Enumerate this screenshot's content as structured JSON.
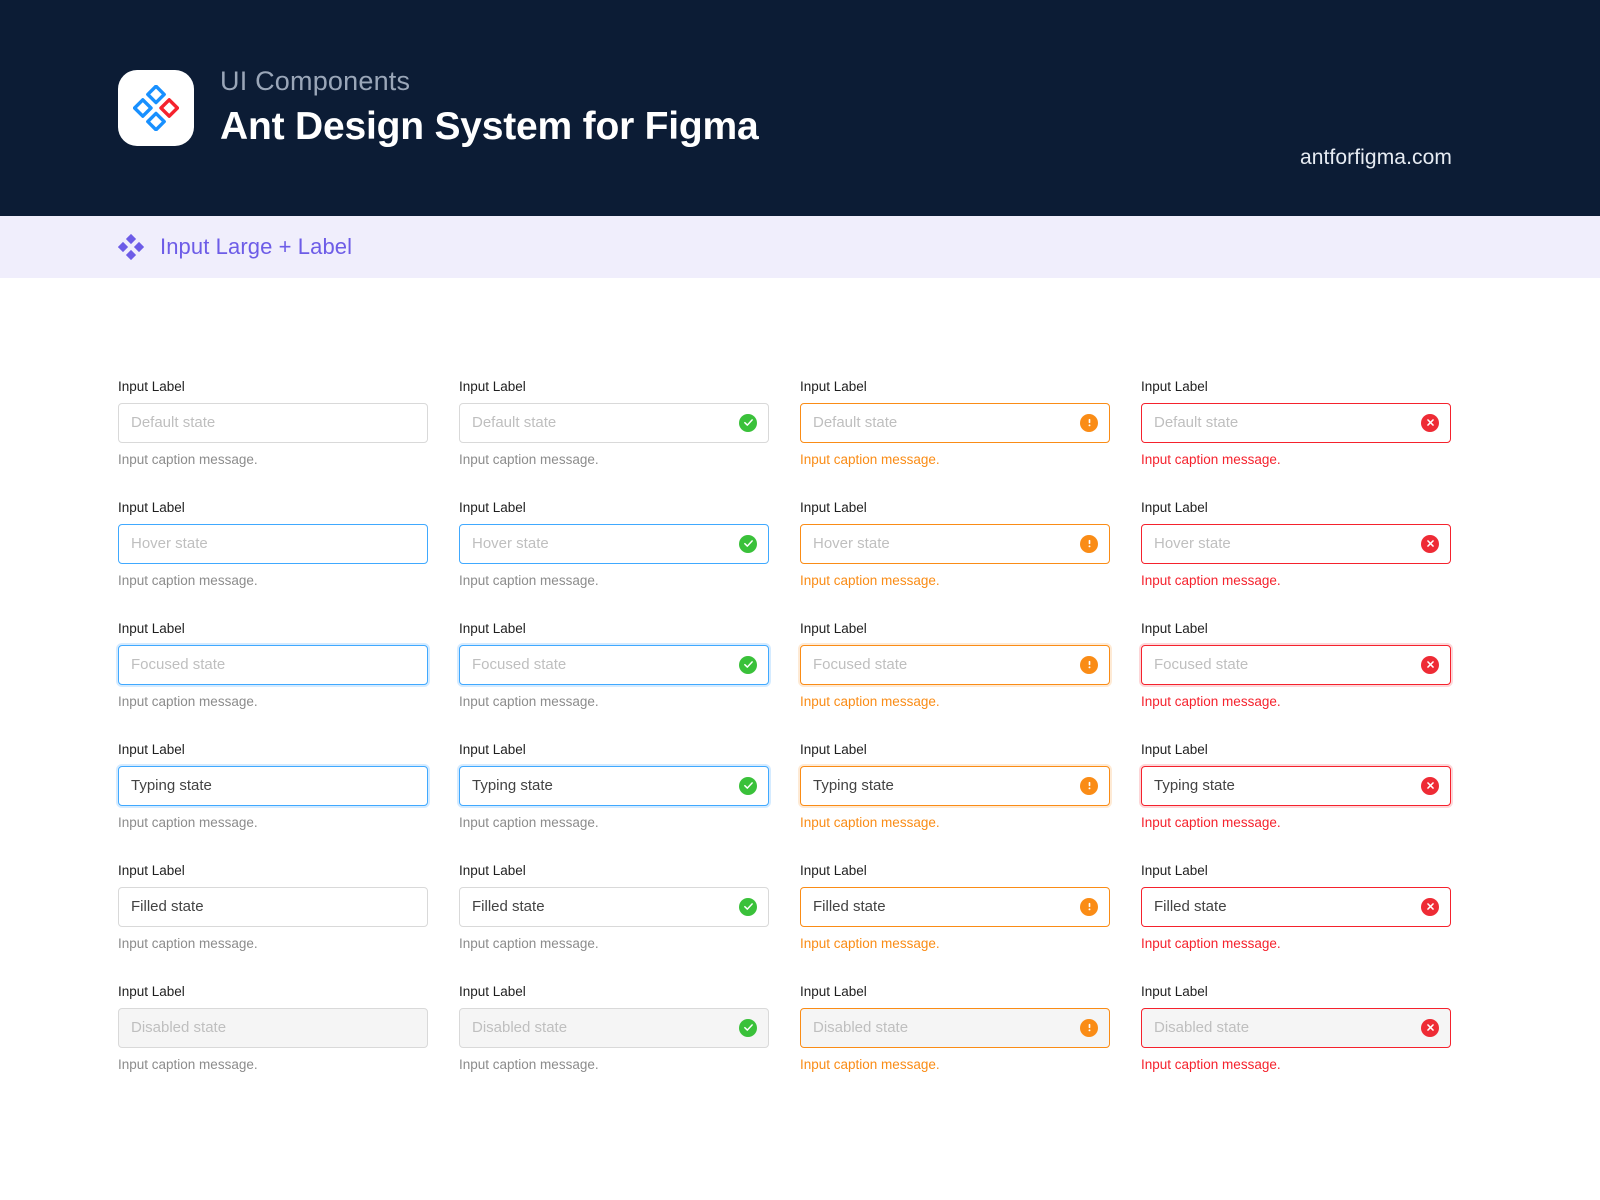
{
  "header": {
    "eyebrow": "UI Components",
    "title": "Ant Design System for Figma",
    "url": "antforfigma.com",
    "logo_icon": "ant-design-diamonds-logo-icon",
    "background_color": "#0c1c35"
  },
  "section": {
    "icon": "four-diamonds-icon",
    "title": "Input Large + Label",
    "background_color": "#f0eefc",
    "text_color": "#6d5ce7"
  },
  "colors": {
    "default_border": "#d9d9d9",
    "primary_blue": "#40a9ff",
    "success_green": "#3ac13a",
    "warning_orange": "#fa8c16",
    "error_red": "#f5222d",
    "disabled_fill": "#f5f5f5",
    "label_text": "#1f1f1f",
    "placeholder_text": "#bfbfbf",
    "value_text": "#434343",
    "caption_text": "#8c8c8c"
  },
  "common": {
    "label": "Input Label",
    "caption": "Input caption message."
  },
  "columns": [
    {
      "name": "neutral",
      "status_icon": null
    },
    {
      "name": "success",
      "status_icon": "check-circle-icon"
    },
    {
      "name": "warning",
      "status_icon": "exclamation-circle-icon"
    },
    {
      "name": "error",
      "status_icon": "close-circle-icon"
    }
  ],
  "rows": [
    {
      "state": "default",
      "value": "Default state"
    },
    {
      "state": "hover",
      "value": "Hover state"
    },
    {
      "state": "focused",
      "value": "Focused state"
    },
    {
      "state": "typing",
      "value": "Typing state"
    },
    {
      "state": "filled",
      "value": "Filled state"
    },
    {
      "state": "disabled",
      "value": "Disabled state"
    }
  ],
  "fields": [
    {
      "label": "Input Label",
      "value": "Default state",
      "caption": "Input caption message.",
      "box_class": "b-default",
      "caption_class": "c-default",
      "icon": null,
      "filled": false,
      "disabled": false
    },
    {
      "label": "Input Label",
      "value": "Default state",
      "caption": "Input caption message.",
      "box_class": "b-default",
      "caption_class": "c-default",
      "icon": "check-circle-icon",
      "filled": false,
      "disabled": false
    },
    {
      "label": "Input Label",
      "value": "Default state",
      "caption": "Input caption message.",
      "box_class": "b-warning",
      "caption_class": "c-warning",
      "icon": "exclamation-circle-icon",
      "filled": false,
      "disabled": false
    },
    {
      "label": "Input Label",
      "value": "Default state",
      "caption": "Input caption message.",
      "box_class": "b-error",
      "caption_class": "c-error",
      "icon": "close-circle-icon",
      "filled": false,
      "disabled": false
    },
    {
      "label": "Input Label",
      "value": "Hover state",
      "caption": "Input caption message.",
      "box_class": "b-hover",
      "caption_class": "c-default",
      "icon": null,
      "filled": false,
      "disabled": false
    },
    {
      "label": "Input Label",
      "value": "Hover state",
      "caption": "Input caption message.",
      "box_class": "b-hover",
      "caption_class": "c-default",
      "icon": "check-circle-icon",
      "filled": false,
      "disabled": false
    },
    {
      "label": "Input Label",
      "value": "Hover state",
      "caption": "Input caption message.",
      "box_class": "b-warning",
      "caption_class": "c-warning",
      "icon": "exclamation-circle-icon",
      "filled": false,
      "disabled": false
    },
    {
      "label": "Input Label",
      "value": "Hover state",
      "caption": "Input caption message.",
      "box_class": "b-error",
      "caption_class": "c-error",
      "icon": "close-circle-icon",
      "filled": false,
      "disabled": false
    },
    {
      "label": "Input Label",
      "value": "Focused state",
      "caption": "Input caption message.",
      "box_class": "b-focus",
      "caption_class": "c-default",
      "icon": null,
      "filled": false,
      "disabled": false
    },
    {
      "label": "Input Label",
      "value": "Focused state",
      "caption": "Input caption message.",
      "box_class": "b-focus",
      "caption_class": "c-default",
      "icon": "check-circle-icon",
      "filled": false,
      "disabled": false
    },
    {
      "label": "Input Label",
      "value": "Focused state",
      "caption": "Input caption message.",
      "box_class": "b-warning-focus",
      "caption_class": "c-warning",
      "icon": "exclamation-circle-icon",
      "filled": false,
      "disabled": false
    },
    {
      "label": "Input Label",
      "value": "Focused state",
      "caption": "Input caption message.",
      "box_class": "b-error-focus",
      "caption_class": "c-error",
      "icon": "close-circle-icon",
      "filled": false,
      "disabled": false
    },
    {
      "label": "Input Label",
      "value": "Typing state",
      "caption": "Input caption message.",
      "box_class": "b-focus",
      "caption_class": "c-default",
      "icon": null,
      "filled": true,
      "disabled": false
    },
    {
      "label": "Input Label",
      "value": "Typing state",
      "caption": "Input caption message.",
      "box_class": "b-focus",
      "caption_class": "c-default",
      "icon": "check-circle-icon",
      "filled": true,
      "disabled": false
    },
    {
      "label": "Input Label",
      "value": "Typing state",
      "caption": "Input caption message.",
      "box_class": "b-warning-focus",
      "caption_class": "c-warning",
      "icon": "exclamation-circle-icon",
      "filled": true,
      "disabled": false
    },
    {
      "label": "Input Label",
      "value": "Typing state",
      "caption": "Input caption message.",
      "box_class": "b-error-focus",
      "caption_class": "c-error",
      "icon": "close-circle-icon",
      "filled": true,
      "disabled": false
    },
    {
      "label": "Input Label",
      "value": "Filled state",
      "caption": "Input caption message.",
      "box_class": "b-default",
      "caption_class": "c-default",
      "icon": null,
      "filled": true,
      "disabled": false
    },
    {
      "label": "Input Label",
      "value": "Filled state",
      "caption": "Input caption message.",
      "box_class": "b-default",
      "caption_class": "c-default",
      "icon": "check-circle-icon",
      "filled": true,
      "disabled": false
    },
    {
      "label": "Input Label",
      "value": "Filled state",
      "caption": "Input caption message.",
      "box_class": "b-warning",
      "caption_class": "c-warning",
      "icon": "exclamation-circle-icon",
      "filled": true,
      "disabled": false
    },
    {
      "label": "Input Label",
      "value": "Filled state",
      "caption": "Input caption message.",
      "box_class": "b-error",
      "caption_class": "c-error",
      "icon": "close-circle-icon",
      "filled": true,
      "disabled": false
    },
    {
      "label": "Input Label",
      "value": "Disabled state",
      "caption": "Input caption message.",
      "box_class": "b-default",
      "caption_class": "c-default",
      "icon": null,
      "filled": false,
      "disabled": true
    },
    {
      "label": "Input Label",
      "value": "Disabled state",
      "caption": "Input caption message.",
      "box_class": "b-default",
      "caption_class": "c-default",
      "icon": "check-circle-icon",
      "filled": false,
      "disabled": true
    },
    {
      "label": "Input Label",
      "value": "Disabled state",
      "caption": "Input caption message.",
      "box_class": "b-warning",
      "caption_class": "c-warning",
      "icon": "exclamation-circle-icon",
      "filled": false,
      "disabled": true
    },
    {
      "label": "Input Label",
      "value": "Disabled state",
      "caption": "Input caption message.",
      "box_class": "b-error",
      "caption_class": "c-error",
      "icon": "close-circle-icon",
      "filled": false,
      "disabled": true
    }
  ]
}
